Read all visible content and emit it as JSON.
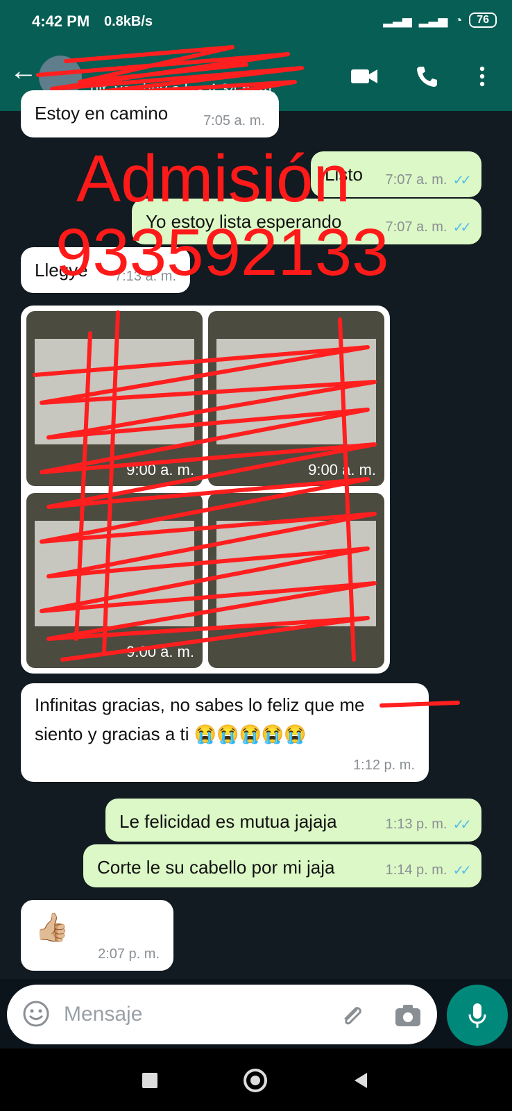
{
  "status_bar": {
    "time": "4:42 PM",
    "info": "0.8kB/s",
    "battery": "76"
  },
  "header": {
    "last_seen": "últ. vez hoy a las 4:34 p. m.",
    "colors": {
      "bar": "#075e54"
    }
  },
  "messages": [
    {
      "direction": "in",
      "text": "Estoy en camino",
      "time": "7:05 a. m."
    },
    {
      "direction": "out",
      "text": "Listo",
      "time": "7:07 a. m."
    },
    {
      "direction": "out",
      "text": "Yo estoy lista esperando",
      "time": "7:07 a. m."
    },
    {
      "direction": "in",
      "text": "Llegye",
      "time": "7:13 a. m."
    },
    {
      "direction": "in",
      "text": "Infinitas gracias, no sabes lo feliz que me",
      "text2": "siento y gracias a ti 😭😭😭😭😭",
      "time": "1:12 p. m."
    },
    {
      "direction": "out",
      "text": "Le felicidad es mutua jajaja",
      "time": "1:13 p. m."
    },
    {
      "direction": "out",
      "text": "Corte le su cabello por mi jaja",
      "time": "1:14 p. m."
    },
    {
      "direction": "in",
      "text": "👍🏼",
      "time": "2:07 p. m."
    }
  ],
  "media": {
    "times": [
      "9:00 a. m.",
      "9:00 a. m.",
      "9:00 a. m."
    ]
  },
  "overlay": {
    "line1": "Admisión",
    "line2": "933592133",
    "color": "#ff1a1a"
  },
  "compose": {
    "placeholder": "Mensaje"
  },
  "colors": {
    "incoming": "#ffffff",
    "outgoing": "#dcf8c6",
    "tick": "#53bdeb",
    "fab": "#00897b"
  }
}
